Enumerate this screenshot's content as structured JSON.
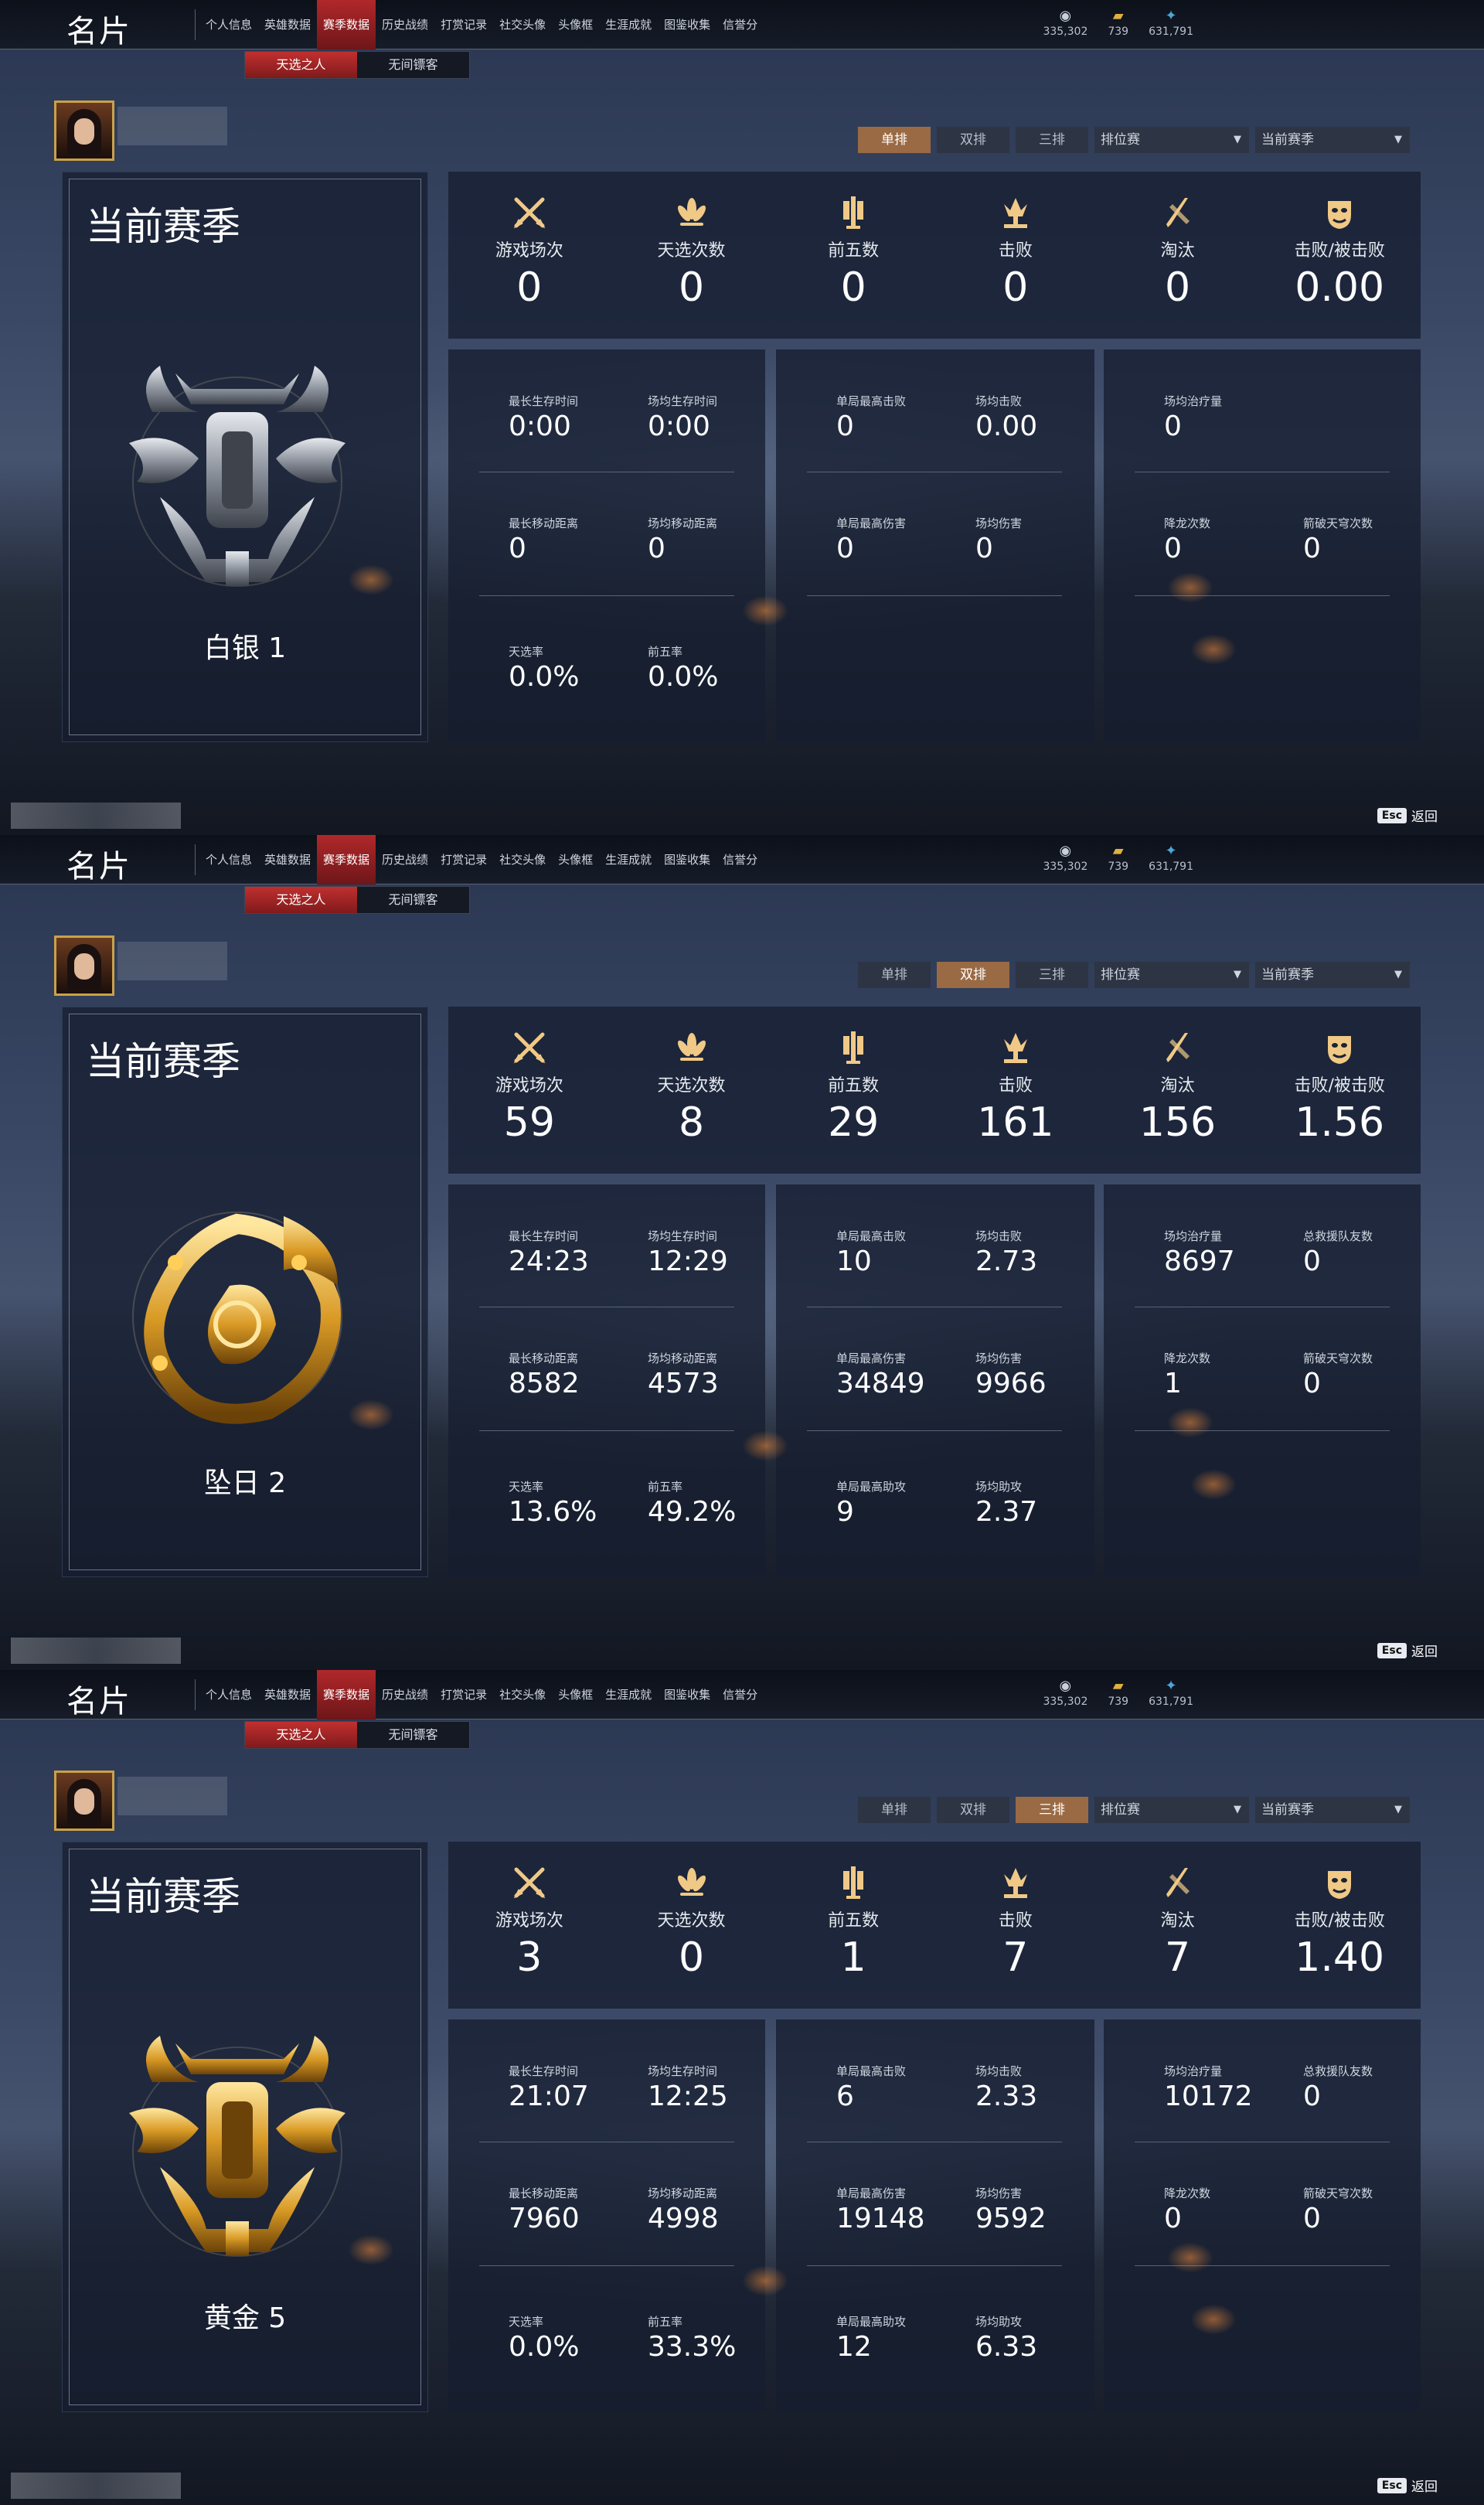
{
  "shared": {
    "app_title": "名片",
    "nav_tabs": [
      "个人信息",
      "英雄数据",
      "赛季数据",
      "历史战绩",
      "打赏记录",
      "社交头像",
      "头像框",
      "生涯成就",
      "图鉴收集",
      "信誉分"
    ],
    "currencies": [
      "335,302",
      "739",
      "631,791"
    ],
    "sub_tabs": [
      "天选之人",
      "无间镖客"
    ],
    "modes": [
      "单排",
      "双排",
      "三排"
    ],
    "dropdown_match": "排位赛",
    "dropdown_season": "当前赛季",
    "season_title": "当前赛季",
    "esc_key": "Esc",
    "back_label": "返回",
    "top_labels": [
      "游戏场次",
      "天选次数",
      "前五数",
      "击败",
      "淘汰",
      "击败/被击败"
    ],
    "icons": [
      "crossed-swords-icon",
      "lotus-icon",
      "sword-banner-icon",
      "crown-trident-icon",
      "slash-blade-icon",
      "mask-icon"
    ]
  },
  "screens": [
    {
      "active_mode": "单排",
      "rank": "白银 1",
      "badge_color": "silver",
      "top_values": [
        "0",
        "0",
        "0",
        "0",
        "0",
        "0.00"
      ],
      "p1": [
        {
          "l": "最长生存时间",
          "v": "0:00"
        },
        {
          "l": "场均生存时间",
          "v": "0:00"
        },
        {
          "l": "最长移动距离",
          "v": "0"
        },
        {
          "l": "场均移动距离",
          "v": "0"
        },
        {
          "l": "天选率",
          "v": "0.0%"
        },
        {
          "l": "前五率",
          "v": "0.0%"
        }
      ],
      "p2": [
        {
          "l": "单局最高击败",
          "v": "0"
        },
        {
          "l": "场均击败",
          "v": "0.00"
        },
        {
          "l": "单局最高伤害",
          "v": "0"
        },
        {
          "l": "场均伤害",
          "v": "0"
        }
      ],
      "p3": [
        {
          "l": "场均治疗量",
          "v": "0"
        },
        {
          "l": "降龙次数",
          "v": "0"
        },
        {
          "l": "箭破天穹次数",
          "v": "0"
        }
      ]
    },
    {
      "active_mode": "双排",
      "rank": "坠日 2",
      "badge_color": "gold-phoenix",
      "top_values": [
        "59",
        "8",
        "29",
        "161",
        "156",
        "1.56"
      ],
      "p1": [
        {
          "l": "最长生存时间",
          "v": "24:23"
        },
        {
          "l": "场均生存时间",
          "v": "12:29"
        },
        {
          "l": "最长移动距离",
          "v": "8582"
        },
        {
          "l": "场均移动距离",
          "v": "4573"
        },
        {
          "l": "天选率",
          "v": "13.6%"
        },
        {
          "l": "前五率",
          "v": "49.2%"
        }
      ],
      "p2": [
        {
          "l": "单局最高击败",
          "v": "10"
        },
        {
          "l": "场均击败",
          "v": "2.73"
        },
        {
          "l": "单局最高伤害",
          "v": "34849"
        },
        {
          "l": "场均伤害",
          "v": "9966"
        },
        {
          "l": "单局最高助攻",
          "v": "9"
        },
        {
          "l": "场均助攻",
          "v": "2.37"
        }
      ],
      "p3": [
        {
          "l": "场均治疗量",
          "v": "8697"
        },
        {
          "l": "总救援队友数",
          "v": "0"
        },
        {
          "l": "降龙次数",
          "v": "1"
        },
        {
          "l": "箭破天穹次数",
          "v": "0"
        }
      ]
    },
    {
      "active_mode": "三排",
      "rank": "黄金 5",
      "badge_color": "gold",
      "top_values": [
        "3",
        "0",
        "1",
        "7",
        "7",
        "1.40"
      ],
      "p1": [
        {
          "l": "最长生存时间",
          "v": "21:07"
        },
        {
          "l": "场均生存时间",
          "v": "12:25"
        },
        {
          "l": "最长移动距离",
          "v": "7960"
        },
        {
          "l": "场均移动距离",
          "v": "4998"
        },
        {
          "l": "天选率",
          "v": "0.0%"
        },
        {
          "l": "前五率",
          "v": "33.3%"
        }
      ],
      "p2": [
        {
          "l": "单局最高击败",
          "v": "6"
        },
        {
          "l": "场均击败",
          "v": "2.33"
        },
        {
          "l": "单局最高伤害",
          "v": "19148"
        },
        {
          "l": "场均伤害",
          "v": "9592"
        },
        {
          "l": "单局最高助攻",
          "v": "12"
        },
        {
          "l": "场均助攻",
          "v": "6.33"
        }
      ],
      "p3": [
        {
          "l": "场均治疗量",
          "v": "10172"
        },
        {
          "l": "总救援队友数",
          "v": "0"
        },
        {
          "l": "降龙次数",
          "v": "0"
        },
        {
          "l": "箭破天穹次数",
          "v": "0"
        }
      ]
    }
  ]
}
